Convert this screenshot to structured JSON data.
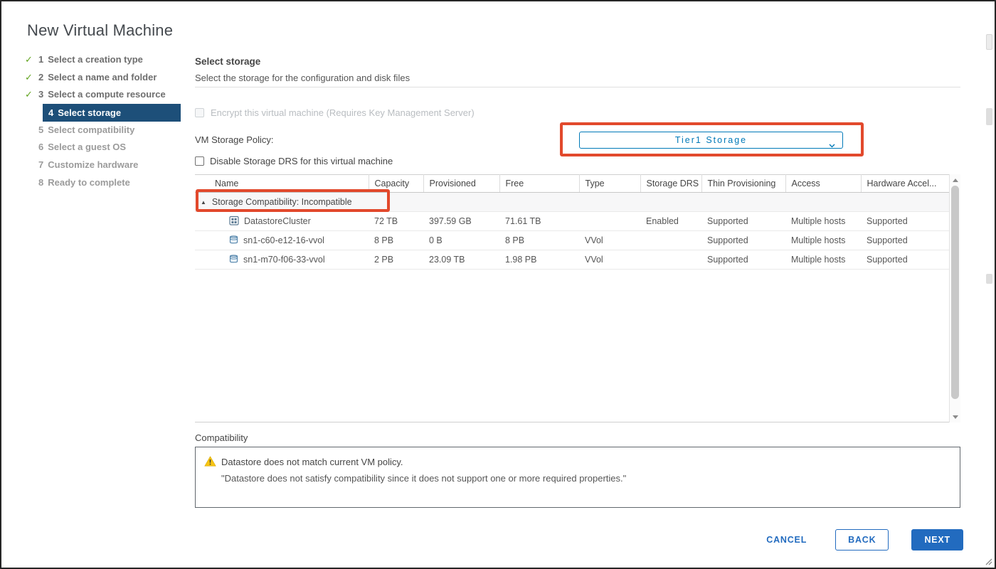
{
  "window": {
    "title": "New Virtual Machine"
  },
  "icons": {
    "step_complete_check": "✓",
    "group_expand_triangle": "▲"
  },
  "steps": [
    {
      "num": "1",
      "label": "Select a creation type",
      "state": "done"
    },
    {
      "num": "2",
      "label": "Select a name and folder",
      "state": "done"
    },
    {
      "num": "3",
      "label": "Select a compute resource",
      "state": "done"
    },
    {
      "num": "4",
      "label": "Select storage",
      "state": "active"
    },
    {
      "num": "5",
      "label": "Select compatibility",
      "state": "upcoming"
    },
    {
      "num": "6",
      "label": "Select a guest OS",
      "state": "upcoming"
    },
    {
      "num": "7",
      "label": "Customize hardware",
      "state": "upcoming"
    },
    {
      "num": "8",
      "label": "Ready to complete",
      "state": "upcoming"
    }
  ],
  "page": {
    "heading": "Select storage",
    "subheading": "Select the storage for the configuration and disk files",
    "encrypt_checkbox_label": "Encrypt this virtual machine (Requires Key Management Server)",
    "vm_storage_policy_label": "VM Storage Policy:",
    "vm_storage_policy_value": "Tier1 Storage",
    "disable_drs_label": "Disable Storage DRS for this virtual machine"
  },
  "table": {
    "columns": [
      "Name",
      "Capacity",
      "Provisioned",
      "Free",
      "Type",
      "Storage DRS",
      "Thin Provisioning",
      "Access",
      "Hardware Accel..."
    ],
    "group_row_label": "Storage Compatibility: Incompatible",
    "rows": [
      {
        "icon": "datastore-cluster-icon",
        "name": "DatastoreCluster",
        "capacity": "72 TB",
        "provisioned": "397.59 GB",
        "free": "71.61 TB",
        "type": "",
        "storage_drs": "Enabled",
        "thin_provisioning": "Supported",
        "access": "Multiple hosts",
        "hardware_accel": "Supported"
      },
      {
        "icon": "datastore-icon",
        "name": "sn1-c60-e12-16-vvol",
        "capacity": "8 PB",
        "provisioned": "0 B",
        "free": "8 PB",
        "type": "VVol",
        "storage_drs": "",
        "thin_provisioning": "Supported",
        "access": "Multiple hosts",
        "hardware_accel": "Supported"
      },
      {
        "icon": "datastore-icon",
        "name": "sn1-m70-f06-33-vvol",
        "capacity": "2 PB",
        "provisioned": "23.09 TB",
        "free": "1.98 PB",
        "type": "VVol",
        "storage_drs": "",
        "thin_provisioning": "Supported",
        "access": "Multiple hosts",
        "hardware_accel": "Supported"
      }
    ]
  },
  "compatibility": {
    "label": "Compatibility",
    "warning_title": "Datastore does not match current VM policy.",
    "warning_detail": "\"Datastore does not satisfy compatibility since it does not support one or more required properties.\""
  },
  "footer": {
    "cancel": "CANCEL",
    "back": "BACK",
    "next": "NEXT"
  },
  "colors": {
    "accent": "#0079b8",
    "action_blue": "#226bbf",
    "active_step_bg": "#1d4f79",
    "step_done_green": "#62a420",
    "annotation": "#e2492c",
    "warning_yellow": "#f8c513"
  }
}
